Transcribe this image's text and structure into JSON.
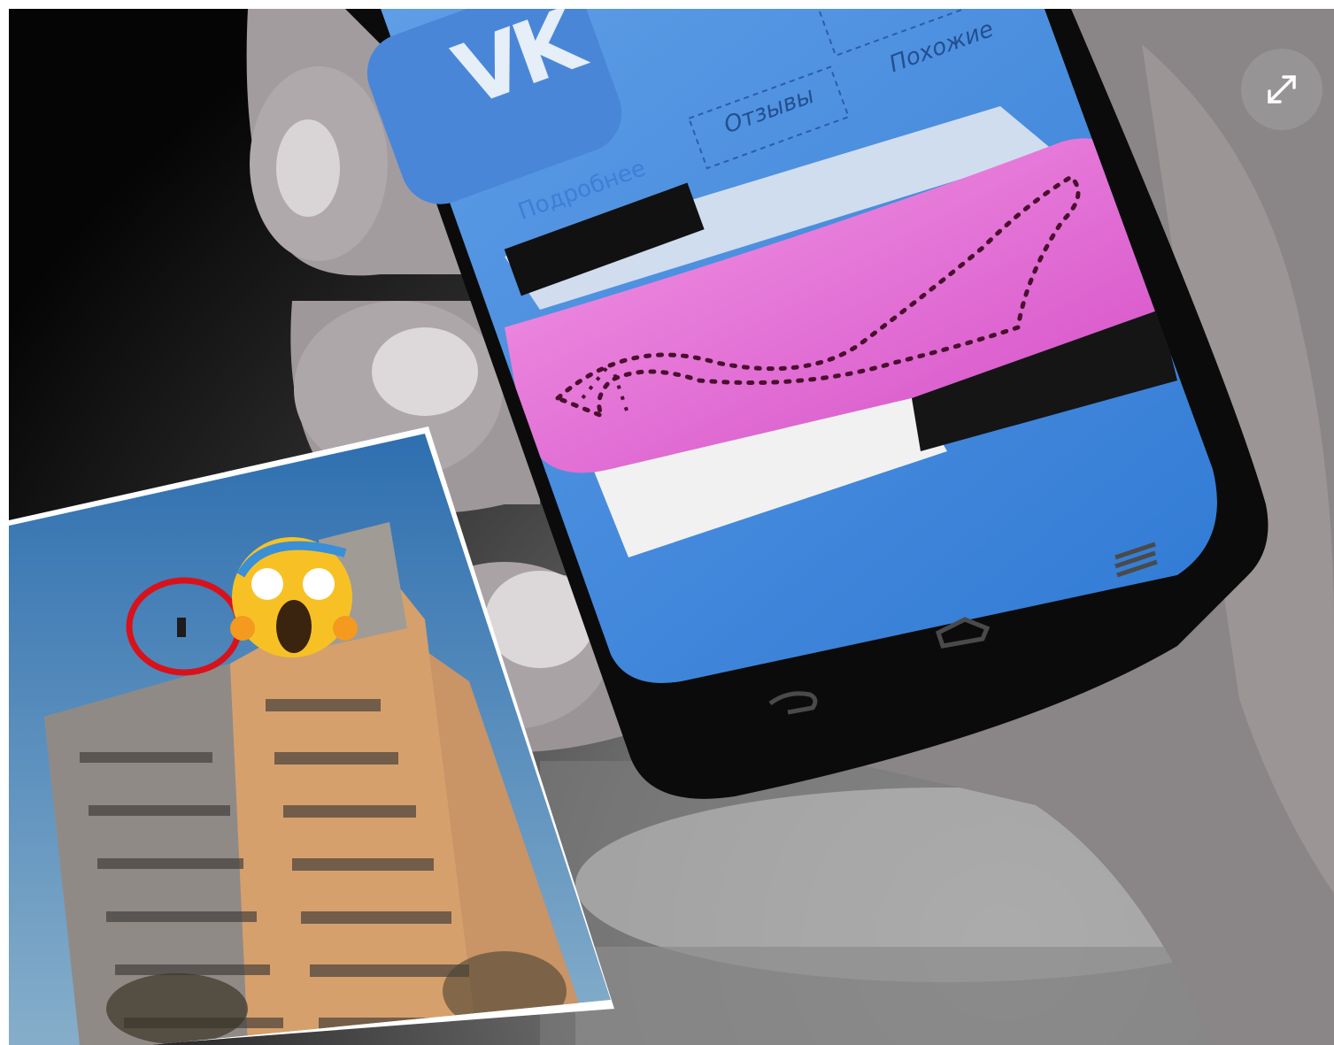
{
  "app": {
    "logo_text": "VK"
  },
  "vk_tabs": [
    {
      "label": "Подробнее"
    },
    {
      "label": "Отзывы"
    },
    {
      "label": "Похожие"
    }
  ],
  "overlay": {
    "expand_icon": "expand-arrows-icon",
    "expand_button_color": "#9a9a9a"
  },
  "colors": {
    "vk_blue": "#4a86d8",
    "tattoo_skin": "#e66fd2",
    "phone_body": "#0b0b0b"
  }
}
